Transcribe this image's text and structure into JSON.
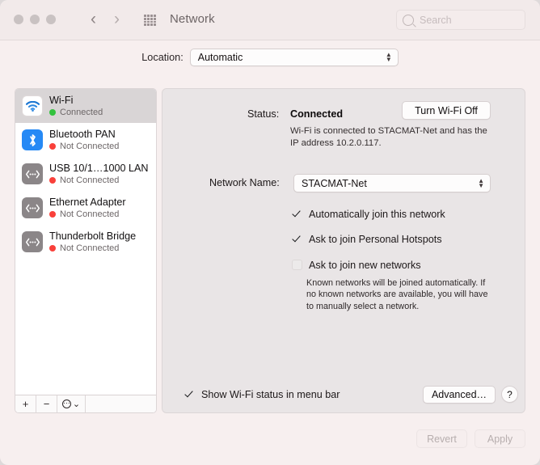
{
  "window": {
    "title": "Network",
    "traffic_lights": [
      "close",
      "minimize",
      "zoom"
    ],
    "nav_back": "‹",
    "nav_forward": "›"
  },
  "search": {
    "placeholder": "Search",
    "value": ""
  },
  "location": {
    "label": "Location:",
    "value": "Automatic",
    "options": [
      "Automatic"
    ]
  },
  "sidebar": {
    "services": [
      {
        "name": "Wi-Fi",
        "status": "Connected",
        "state": "connected",
        "icon": "wifi-icon",
        "selected": true
      },
      {
        "name": "Bluetooth PAN",
        "status": "Not Connected",
        "state": "disconnected",
        "icon": "bluetooth-icon",
        "selected": false
      },
      {
        "name": "USB 10/1…1000 LAN",
        "status": "Not Connected",
        "state": "disconnected",
        "icon": "ethernet-icon",
        "selected": false
      },
      {
        "name": "Ethernet Adapter",
        "status": "Not Connected",
        "state": "disconnected",
        "icon": "ethernet-icon",
        "selected": false
      },
      {
        "name": "Thunderbolt Bridge",
        "status": "Not Connected",
        "state": "disconnected",
        "icon": "ethernet-icon",
        "selected": false
      }
    ],
    "toolbar": {
      "add": "+",
      "remove": "−",
      "action_menu": "⋯",
      "action_chevron": "⌄"
    }
  },
  "main": {
    "status_label": "Status:",
    "status_value": "Connected",
    "turn_wifi_off": "Turn Wi-Fi Off",
    "status_description": "Wi-Fi is connected to STACMAT-Net and has the IP address 10.2.0.117.",
    "network_name_label": "Network Name:",
    "network_name_value": "STACMAT-Net",
    "checkboxes": [
      {
        "label": "Automatically join this network",
        "checked": true
      },
      {
        "label": "Ask to join Personal Hotspots",
        "checked": true
      },
      {
        "label": "Ask to join new networks",
        "checked": false
      }
    ],
    "known_networks_note": "Known networks will be joined automatically. If no known networks are available, you will have to manually select a network.",
    "show_status_menu_bar": {
      "label": "Show Wi-Fi status in menu bar",
      "checked": true
    },
    "advanced_button": "Advanced…",
    "help_button": "?"
  },
  "footer": {
    "revert": "Revert",
    "apply": "Apply",
    "enabled": false
  },
  "colors": {
    "window_background": "#f7efef",
    "pane_background": "#e9e5e6",
    "sidebar_background": "#ffffff",
    "selected_row": "#d9d5d6",
    "connected_dot": "#33c23e",
    "disconnected_dot": "#f9403a",
    "bluetooth_blue": "#2689f5",
    "wifi_blue": "#1a75d1"
  }
}
